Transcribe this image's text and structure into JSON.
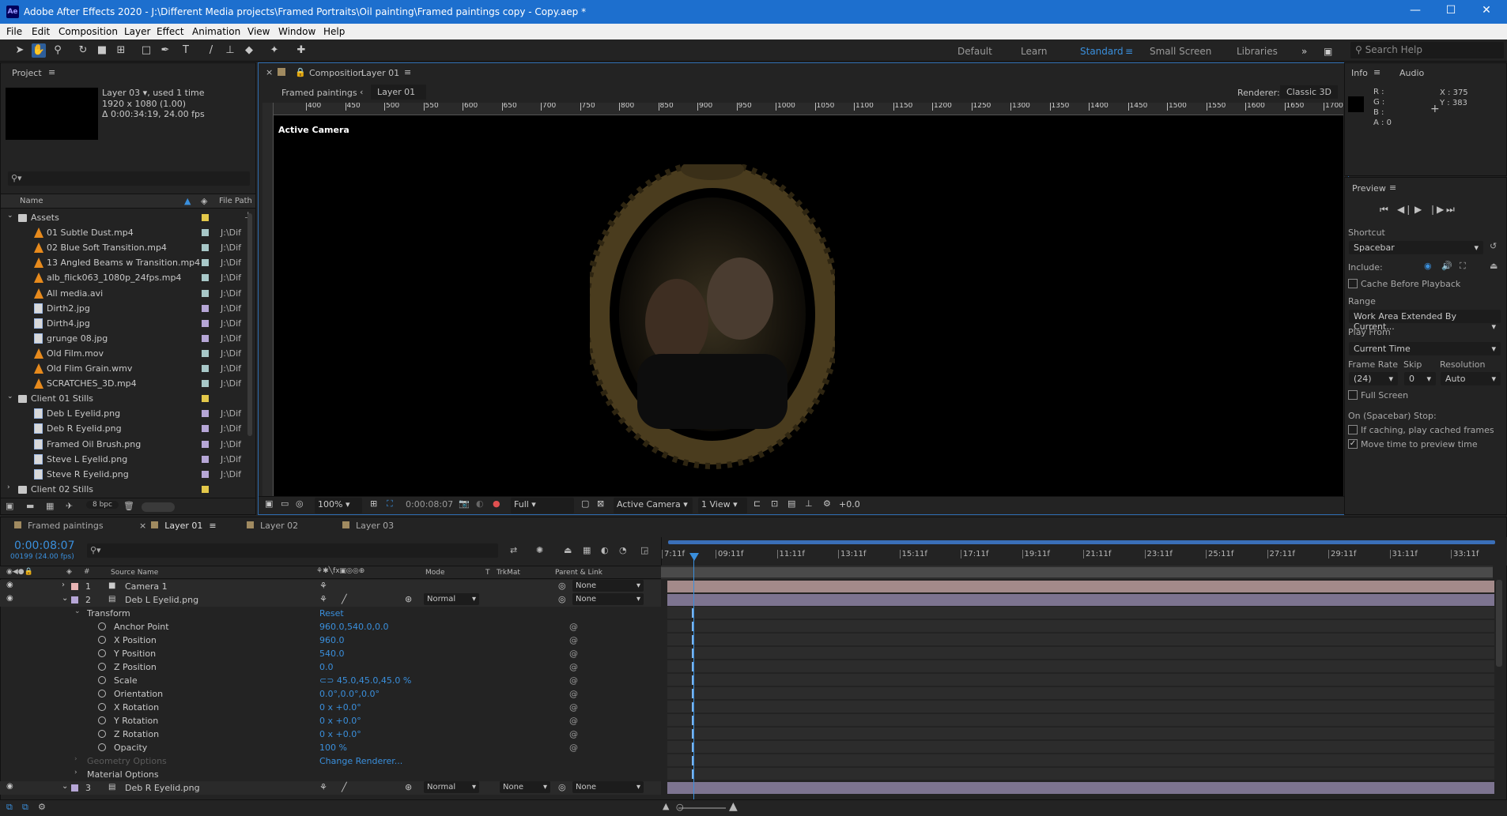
{
  "app": {
    "title": "Adobe After Effects 2020 - J:\\Different Media projects\\Framed Portraits\\Oil painting\\Framed paintings copy - Copy.aep *",
    "logo": "Ae"
  },
  "menu": [
    "File",
    "Edit",
    "Composition",
    "Layer",
    "Effect",
    "Animation",
    "View",
    "Window",
    "Help"
  ],
  "workspaces": {
    "items": [
      "Default",
      "Learn",
      "Standard",
      "Small Screen",
      "Libraries"
    ],
    "active": "Standard",
    "search_placeholder": "Search Help"
  },
  "project": {
    "tab": "Project",
    "selected_name": "Layer 03",
    "used": ", used 1 time",
    "dims": "1920 x 1080 (1.00)",
    "duration": "Δ 0:00:34:19, 24.00 fps",
    "search_placeholder": "⚲▾",
    "col_name": "Name",
    "col_path": "File Path",
    "bpc": "8 bpc",
    "rows": [
      {
        "name": "Assets",
        "type": "folder",
        "indent": 0,
        "label": "#e3c84a",
        "path": ""
      },
      {
        "name": "01 Subtle Dust.mp4",
        "type": "video",
        "indent": 1,
        "label": "#a8c8c8",
        "path": "J:\\Dif"
      },
      {
        "name": "02 Blue Soft Transition.mp4",
        "type": "video",
        "indent": 1,
        "label": "#a8c8c8",
        "path": "J:\\Dif"
      },
      {
        "name": "13 Angled Beams w Transition.mp4",
        "type": "video",
        "indent": 1,
        "label": "#a8c8c8",
        "path": "J:\\Dif"
      },
      {
        "name": "alb_flick063_1080p_24fps.mp4",
        "type": "video",
        "indent": 1,
        "label": "#a8c8c8",
        "path": "J:\\Dif"
      },
      {
        "name": "All media.avi",
        "type": "video",
        "indent": 1,
        "label": "#a8c8c8",
        "path": "J:\\Dif"
      },
      {
        "name": "Dirth2.jpg",
        "type": "image",
        "indent": 1,
        "label": "#b6a6d6",
        "path": "J:\\Dif"
      },
      {
        "name": "Dirth4.jpg",
        "type": "image",
        "indent": 1,
        "label": "#b6a6d6",
        "path": "J:\\Dif"
      },
      {
        "name": "grunge 08.jpg",
        "type": "image",
        "indent": 1,
        "label": "#b6a6d6",
        "path": "J:\\Dif"
      },
      {
        "name": "Old Film.mov",
        "type": "video",
        "indent": 1,
        "label": "#a8c8c8",
        "path": "J:\\Dif"
      },
      {
        "name": "Old Flim Grain.wmv",
        "type": "video",
        "indent": 1,
        "label": "#a8c8c8",
        "path": "J:\\Dif"
      },
      {
        "name": "SCRATCHES_3D.mp4",
        "type": "video",
        "indent": 1,
        "label": "#a8c8c8",
        "path": "J:\\Dif"
      },
      {
        "name": "Client 01 Stills",
        "type": "folder",
        "indent": 0,
        "label": "#e3c84a",
        "path": ""
      },
      {
        "name": "Deb L Eyelid.png",
        "type": "image",
        "indent": 1,
        "label": "#b6a6d6",
        "path": "J:\\Dif"
      },
      {
        "name": "Deb R Eyelid.png",
        "type": "image",
        "indent": 1,
        "label": "#b6a6d6",
        "path": "J:\\Dif"
      },
      {
        "name": "Framed Oil Brush.png",
        "type": "image",
        "indent": 1,
        "label": "#b6a6d6",
        "path": "J:\\Dif"
      },
      {
        "name": "Steve L Eyelid.png",
        "type": "image",
        "indent": 1,
        "label": "#b6a6d6",
        "path": "J:\\Dif"
      },
      {
        "name": "Steve R Eyelid.png",
        "type": "image",
        "indent": 1,
        "label": "#b6a6d6",
        "path": "J:\\Dif"
      },
      {
        "name": "Client 02 Stills",
        "type": "folder",
        "indent": 0,
        "label": "#e3c84a",
        "path": ""
      }
    ]
  },
  "composition": {
    "tab_prefix": "Composition",
    "tab_name": "Layer 01",
    "breadcrumb_parent": "Framed paintings",
    "breadcrumb_current": "Layer 01",
    "renderer_label": "Renderer:",
    "renderer_value": "Classic 3D",
    "camera_label": "Active Camera",
    "ruler_ticks": [
      "400",
      "450",
      "500",
      "550",
      "600",
      "650",
      "700",
      "750",
      "800",
      "850",
      "900",
      "950",
      "1000",
      "1050",
      "1100",
      "1150",
      "1200",
      "1250",
      "1300",
      "1350",
      "1400",
      "1450",
      "1500",
      "1550",
      "1600",
      "1650",
      "1700"
    ],
    "zoom": "100%",
    "timecode": "0:00:08:07",
    "resolution": "Full",
    "view": "Active Camera",
    "views": "1 View",
    "exposure": "+0.0"
  },
  "info": {
    "tab": "Info",
    "tab2": "Audio",
    "r": "R :",
    "g": "G :",
    "b": "B :",
    "a": "A : 0",
    "x": "X : 375",
    "y": "Y : 383"
  },
  "preview": {
    "title": "Preview",
    "shortcut_label": "Shortcut",
    "shortcut": "Spacebar",
    "include_label": "Include:",
    "cache_label": "Cache Before Playback",
    "range_label": "Range",
    "range": "Work Area Extended By Current...",
    "playfrom_label": "Play From",
    "playfrom": "Current Time",
    "framerate_label": "Frame Rate",
    "skip_label": "Skip",
    "resolution_label": "Resolution",
    "framerate": "(24)",
    "skip": "0",
    "resolution": "Auto",
    "fullscreen_label": "Full Screen",
    "stop_label": "On (Spacebar) Stop:",
    "ifcaching_label": "If caching, play cached frames",
    "movetime_label": "Move time to preview time"
  },
  "timeline": {
    "tabs": [
      {
        "name": "Framed paintings",
        "color": "#a08a60"
      },
      {
        "name": "Layer 01",
        "color": "#a08a60",
        "active": true
      },
      {
        "name": "Layer 02",
        "color": "#a08a60"
      },
      {
        "name": "Layer 03",
        "color": "#a08a60"
      }
    ],
    "timecode": "0:00:08:07",
    "frames": "00199 (24.00 fps)",
    "search_placeholder": "⚲▾",
    "col_num": "#",
    "col_source": "Source Name",
    "col_mode": "Mode",
    "col_t": "T",
    "col_trkmat": "TrkMat",
    "col_parent": "Parent & Link",
    "ruler": [
      "7:11f",
      "09:11f",
      "11:11f",
      "13:11f",
      "15:11f",
      "17:11f",
      "19:11f",
      "21:11f",
      "23:11f",
      "25:11f",
      "27:11f",
      "29:11f",
      "31:11f",
      "33:11f"
    ],
    "layers": [
      {
        "num": "1",
        "name": "Camera 1",
        "mode": "",
        "trkmat": "",
        "parent": "None",
        "color": "#e8b4b4"
      },
      {
        "num": "2",
        "name": "Deb L Eyelid.png",
        "mode": "Normal",
        "trkmat": "",
        "parent": "None",
        "color": "#b6a6d6"
      },
      {
        "num": "3",
        "name": "Deb R Eyelid.png",
        "mode": "Normal",
        "trkmat": "None",
        "parent": "None",
        "color": "#b6a6d6"
      }
    ],
    "transform_label": "Transform",
    "reset": "Reset",
    "props": [
      {
        "name": "Anchor Point",
        "value": "960.0,540.0,0.0"
      },
      {
        "name": "X Position",
        "value": "960.0"
      },
      {
        "name": "Y Position",
        "value": "540.0"
      },
      {
        "name": "Z Position",
        "value": "0.0"
      },
      {
        "name": "Scale",
        "value": "⊂⊃ 45.0,45.0,45.0 %"
      },
      {
        "name": "Orientation",
        "value": "0.0°,0.0°,0.0°"
      },
      {
        "name": "X Rotation",
        "value": "0 x +0.0°"
      },
      {
        "name": "Y Rotation",
        "value": "0 x +0.0°"
      },
      {
        "name": "Z Rotation",
        "value": "0 x +0.0°"
      },
      {
        "name": "Opacity",
        "value": "100 %"
      }
    ],
    "geometry_label": "Geometry Options",
    "change_renderer": "Change Renderer...",
    "material_label": "Material Options"
  }
}
